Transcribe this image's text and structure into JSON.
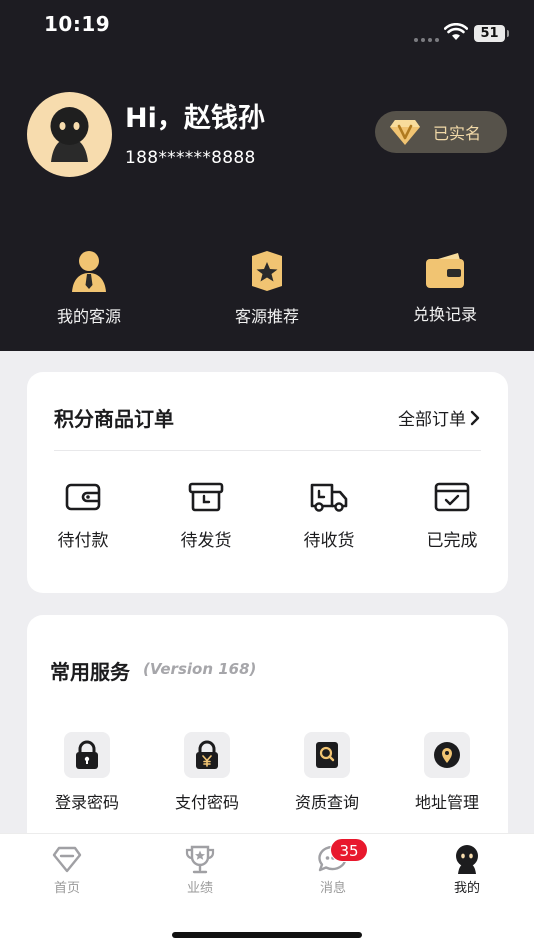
{
  "status_bar": {
    "time": "10:19",
    "battery": "51"
  },
  "profile": {
    "greeting": "Hi，赵钱孙",
    "phone": "188******8888",
    "verified_label": "已实名",
    "verified_icon": "v-gem-icon"
  },
  "quick_actions": [
    {
      "label": "我的客源",
      "icon": "person-tie-icon"
    },
    {
      "label": "客源推荐",
      "icon": "star-shield-icon"
    },
    {
      "label": "兑换记录",
      "icon": "wallet-icon"
    }
  ],
  "orders": {
    "title": "积分商品订单",
    "all_label": "全部订单",
    "items": [
      {
        "label": "待付款",
        "icon": "wallet-outline-icon"
      },
      {
        "label": "待发货",
        "icon": "box-clock-icon"
      },
      {
        "label": "待收货",
        "icon": "truck-icon"
      },
      {
        "label": "已完成",
        "icon": "check-box-icon"
      }
    ]
  },
  "services": {
    "title": "常用服务",
    "version": "(Version 168)",
    "items": [
      {
        "label": "登录密码",
        "icon": "lock-icon"
      },
      {
        "label": "支付密码",
        "icon": "yen-lock-icon"
      },
      {
        "label": "资质查询",
        "icon": "doc-search-icon"
      },
      {
        "label": "地址管理",
        "icon": "location-pin-icon"
      }
    ]
  },
  "tabbar": {
    "items": [
      {
        "label": "首页",
        "icon": "diamond-icon",
        "active": false
      },
      {
        "label": "业绩",
        "icon": "trophy-icon",
        "active": false
      },
      {
        "label": "消息",
        "icon": "chat-bubble-icon",
        "active": false
      },
      {
        "label": "我的",
        "icon": "user-avatar-icon",
        "active": true
      }
    ],
    "message_badge": "35"
  },
  "colors": {
    "header_bg": "#1d1c22",
    "accent_gold": "#f1c472",
    "badge_red": "#e8182d"
  }
}
